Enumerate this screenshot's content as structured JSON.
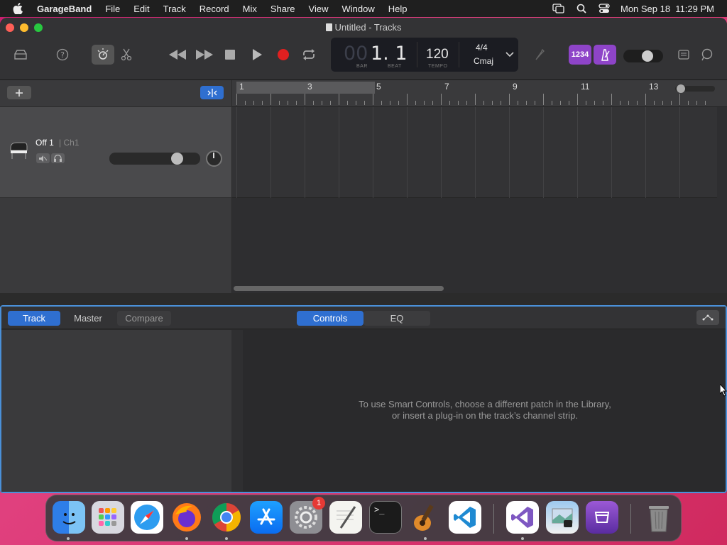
{
  "menubar": {
    "app": "GarageBand",
    "items": [
      "File",
      "Edit",
      "Track",
      "Record",
      "Mix",
      "Share",
      "View",
      "Window",
      "Help"
    ],
    "clock": "Mon Sep 18  11:29 PM"
  },
  "window": {
    "title": "Untitled - Tracks"
  },
  "lcd": {
    "bar_dim": "00",
    "position": "1. 1",
    "bar_label": "BAR",
    "beat_label": "BEAT",
    "tempo": "120",
    "tempo_label": "TEMPO",
    "signature": "4/4",
    "key": "Cmaj"
  },
  "toolbar": {
    "count_in": "1234"
  },
  "track": {
    "name": "Off 1",
    "channel": "| Ch1",
    "volume": 0.78
  },
  "ruler": {
    "bars": [
      "1",
      "3",
      "5",
      "7",
      "9",
      "11",
      "13"
    ]
  },
  "smart_controls": {
    "tabs": [
      "Track",
      "Master",
      "Compare"
    ],
    "selected_tab": "Track",
    "views": [
      "Controls",
      "EQ"
    ],
    "selected_view": "Controls",
    "message_line1": "To use Smart Controls, choose a different patch in the Library,",
    "message_line2": "or insert a plug-in on the track’s channel strip."
  },
  "dock": {
    "apps": [
      "finder-icon",
      "launchpad-icon",
      "safari-icon",
      "firefox-icon",
      "chrome-icon",
      "app-store-icon",
      "system-settings-icon",
      "textedit-icon",
      "terminal-icon",
      "garageband-icon",
      "vscode-icon",
      "visual-studio-icon",
      "preview-icon",
      "simulator-icon",
      "trash-icon"
    ],
    "settings_badge": "1"
  },
  "colors": {
    "accent": "#2f6fd0",
    "record": "#e02020",
    "purple": "#8e44c8"
  }
}
